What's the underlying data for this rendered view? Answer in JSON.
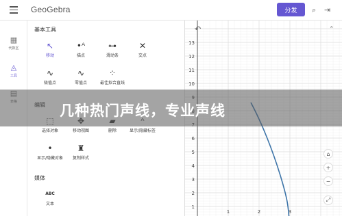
{
  "header": {
    "logo": "GeoGebra",
    "share_label": "分发",
    "search_icon": "search-icon",
    "login_icon": "sign-in-icon"
  },
  "rail": {
    "items": [
      {
        "label": "代数区",
        "icon": "calculator-icon"
      },
      {
        "label": "工具",
        "icon": "shapes-icon"
      },
      {
        "label": "表格",
        "icon": "table-icon"
      }
    ]
  },
  "tools": {
    "basic_title": "基本工具",
    "basic": [
      {
        "label": "移动",
        "icon": "cursor-icon"
      },
      {
        "label": "描点",
        "icon": "point-icon"
      },
      {
        "label": "滑动条",
        "icon": "slider-icon"
      },
      {
        "label": "交点",
        "icon": "intersect-icon"
      },
      {
        "label": "极值点",
        "icon": "extremum-icon"
      },
      {
        "label": "零值点",
        "icon": "roots-icon"
      },
      {
        "label": "最佳拟合直线",
        "icon": "best-fit-icon"
      }
    ],
    "edit_title": "编辑",
    "edit": [
      {
        "label": "选择对象",
        "icon": "select-icon"
      },
      {
        "label": "移动视图",
        "icon": "move-view-icon"
      },
      {
        "label": "删除",
        "icon": "delete-icon"
      },
      {
        "label": "显示/隐藏标签",
        "icon": "label-icon"
      },
      {
        "label": "显示/隐藏对象",
        "icon": "show-hide-icon"
      },
      {
        "label": "复制样式",
        "icon": "copy-style-icon"
      }
    ],
    "media_title": "媒体",
    "media": [
      {
        "label": "文本",
        "icon_text": "ABC"
      }
    ]
  },
  "graphics": {
    "y_ticks": [
      "13",
      "12",
      "11",
      "10",
      "9",
      "8",
      "7",
      "6",
      "5",
      "4",
      "3",
      "2",
      "1"
    ],
    "x_ticks": [
      "1",
      "2",
      "3"
    ],
    "undo_icon": "undo-icon",
    "collapse_icon": "collapse-icon",
    "zoom_buttons": [
      "home-icon",
      "zoom-in-icon",
      "zoom-out-icon",
      "fullscreen-icon"
    ]
  },
  "overlay": {
    "title": "几种热门声线，专业声线"
  }
}
